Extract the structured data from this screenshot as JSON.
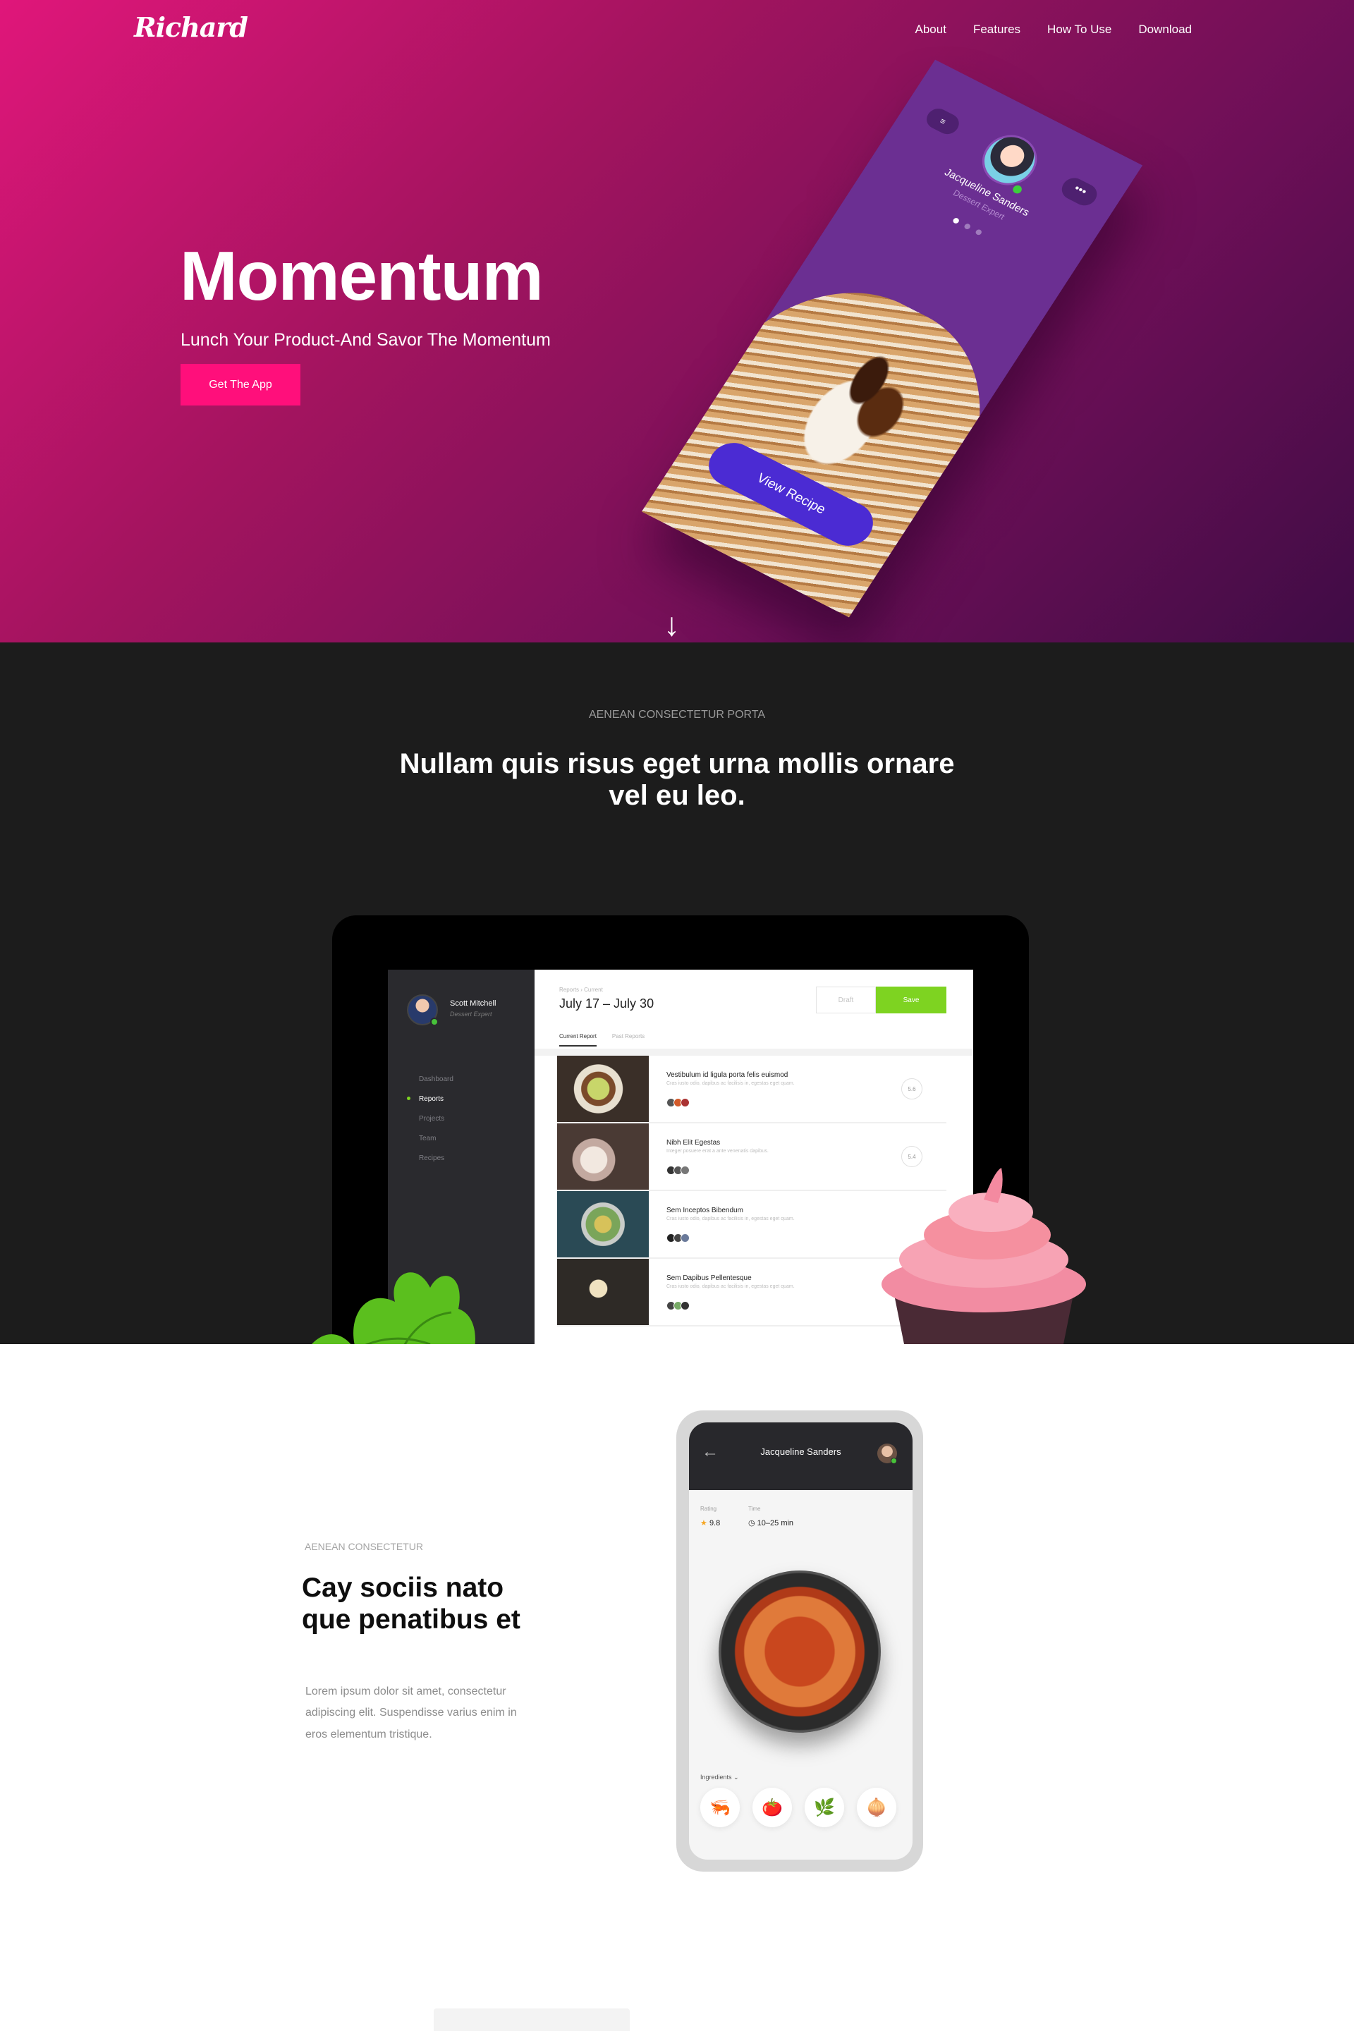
{
  "brand": {
    "logo": "Richard"
  },
  "nav": {
    "items": [
      "About",
      "Features",
      "How To Use",
      "Download"
    ]
  },
  "hero": {
    "title": "Momentum",
    "subtitle": "Lunch Your Product-And Savor The Momentum",
    "cta": "Get The App",
    "scroll_icon": "arrow-down-icon"
  },
  "hero_phone": {
    "name": "Jacqueline Sanders",
    "role": "Dessert Expert",
    "button": "View Recipe"
  },
  "section2": {
    "eyebrow": "AENEAN CONSECTETUR PORTA",
    "title": "Nullam quis risus eget urna mollis ornare vel eu leo."
  },
  "tablet": {
    "user": "Scott Mitchell",
    "user_role": "Dessert Expert",
    "menu": [
      "Dashboard",
      "Reports",
      "Projects",
      "Team",
      "Recipes"
    ],
    "active_menu": "Reports",
    "breadcrumb": "Reports  ›  Current",
    "date_range": "July 17 – July 30",
    "draft_label": "Draft",
    "save_label": "Save",
    "tabs": [
      "Current Report",
      "Past Reports"
    ],
    "rows": [
      {
        "title": "Vestibulum id ligula porta felis euismod",
        "desc": "Cras iusto odio, dapibus ac facilisis in, egestas eget quam.",
        "score": "5.6"
      },
      {
        "title": "Nibh Elit Egestas",
        "desc": "Integer posuere erat a ante venenatis dapibus.",
        "score": "5.4"
      },
      {
        "title": "Sem Inceptos Bibendum",
        "desc": "Cras iusto odio, dapibus ac facilisis in, egestas eget quam.",
        "score": ""
      },
      {
        "title": "Sem Dapibus Pellentesque",
        "desc": "Cras iusto odio, dapibus ac facilisis in, egestas eget quam.",
        "score": ""
      }
    ],
    "colors": {
      "accent": "#7ed321"
    }
  },
  "section3": {
    "eyebrow": "AENEAN CONSECTETUR",
    "title": "Cay sociis nato que penatibus et",
    "body": "Lorem ipsum dolor sit amet, consectetur adipiscing elit. Suspendisse varius enim in eros elementum tristique."
  },
  "phone2": {
    "name": "Jacqueline Sanders",
    "rating_label": "Rating",
    "rating_value": "9.8",
    "time_label": "Time",
    "time_value": "10–25 min",
    "ingredients_label": "Ingredients ⌄",
    "ingredients": [
      "🦐",
      "🍅",
      "🌿",
      "🧅"
    ]
  },
  "colors": {
    "primary": "#ff0f7b",
    "dark_bg": "#1c1c1c",
    "hero_start": "#e0167a",
    "hero_end": "#3f0c45"
  }
}
